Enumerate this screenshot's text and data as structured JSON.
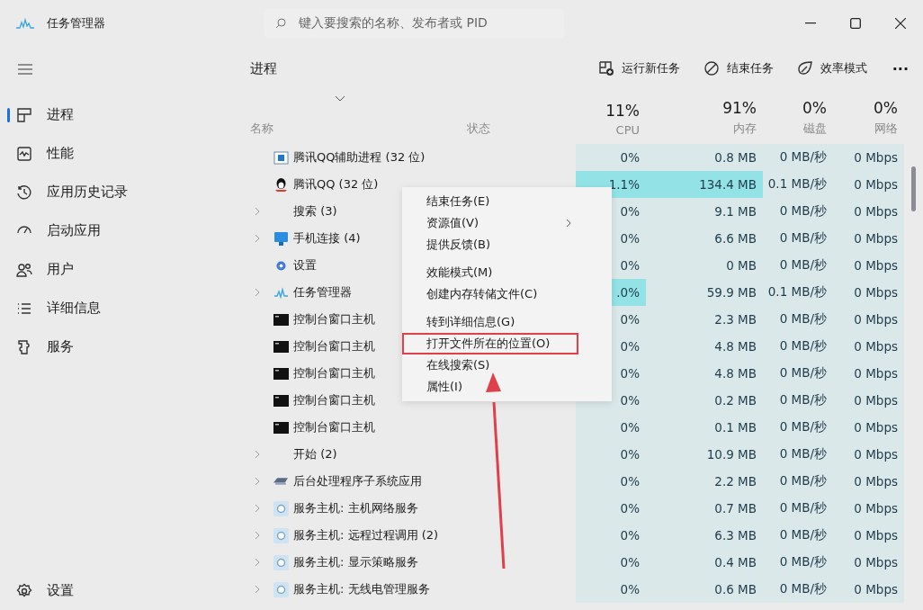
{
  "window": {
    "title": "任务管理器"
  },
  "search": {
    "placeholder": "键入要搜索的名称、发布者或 PID"
  },
  "sidebar": {
    "items": [
      {
        "label": "进程",
        "selected": true
      },
      {
        "label": "性能",
        "selected": false
      },
      {
        "label": "应用历史记录",
        "selected": false
      },
      {
        "label": "启动应用",
        "selected": false
      },
      {
        "label": "用户",
        "selected": false
      },
      {
        "label": "详细信息",
        "selected": false
      },
      {
        "label": "服务",
        "selected": false
      }
    ],
    "footer": {
      "label": "设置"
    }
  },
  "page": {
    "title": "进程",
    "actions": [
      {
        "label": "运行新任务"
      },
      {
        "label": "结束任务"
      },
      {
        "label": "效率模式"
      }
    ],
    "more": "···"
  },
  "table": {
    "columns": [
      {
        "label": "名称"
      },
      {
        "label": "状态"
      },
      {
        "label": "CPU",
        "total": "11%"
      },
      {
        "label": "内存",
        "total": "91%"
      },
      {
        "label": "磁盘",
        "total": "0%"
      },
      {
        "label": "网络",
        "total": "0%"
      }
    ],
    "rows": [
      {
        "name": "腾讯QQ辅助进程 (32 位)",
        "expandable": false,
        "kind": "app",
        "cpu": "0%",
        "memory": "0.8 MB",
        "disk": "0 MB/秒",
        "network": "0 Mbps",
        "cpu_hot": false,
        "mem_hot": false
      },
      {
        "name": "腾讯QQ (32 位)",
        "expandable": false,
        "kind": "penguin",
        "cpu": "1.1%",
        "memory": "134.4 MB",
        "disk": "0.1 MB/秒",
        "network": "0 Mbps",
        "cpu_hot": true,
        "mem_hot": true
      },
      {
        "name": "搜索 (3)",
        "expandable": true,
        "kind": "group",
        "cpu": "0%",
        "memory": "9.1 MB",
        "disk": "0 MB/秒",
        "network": "0 Mbps",
        "cpu_hot": false,
        "mem_hot": false
      },
      {
        "name": "手机连接 (4)",
        "expandable": true,
        "kind": "monitor",
        "cpu": "0%",
        "memory": "6.6 MB",
        "disk": "0 MB/秒",
        "network": "0 Mbps",
        "cpu_hot": false,
        "mem_hot": false
      },
      {
        "name": "设置",
        "expandable": false,
        "kind": "gear",
        "cpu": "0%",
        "memory": "0 MB",
        "disk": "0 MB/秒",
        "network": "0 Mbps",
        "cpu_hot": false,
        "mem_hot": false
      },
      {
        "name": "任务管理器",
        "expandable": true,
        "kind": "pulse",
        "cpu": ".0%",
        "memory": "59.9 MB",
        "disk": "0.1 MB/秒",
        "network": "0 Mbps",
        "cpu_hot": true,
        "mem_hot": false
      },
      {
        "name": "控制台窗口主机",
        "expandable": false,
        "kind": "console",
        "cpu": "0%",
        "memory": "2.3 MB",
        "disk": "0 MB/秒",
        "network": "0 Mbps",
        "cpu_hot": false,
        "mem_hot": false
      },
      {
        "name": "控制台窗口主机",
        "expandable": false,
        "kind": "console",
        "cpu": "0%",
        "memory": "4.8 MB",
        "disk": "0 MB/秒",
        "network": "0 Mbps",
        "cpu_hot": false,
        "mem_hot": false
      },
      {
        "name": "控制台窗口主机",
        "expandable": false,
        "kind": "console",
        "cpu": "0%",
        "memory": "4.8 MB",
        "disk": "0 MB/秒",
        "network": "0 Mbps",
        "cpu_hot": false,
        "mem_hot": false
      },
      {
        "name": "控制台窗口主机",
        "expandable": false,
        "kind": "console",
        "cpu": "0%",
        "memory": "0.2 MB",
        "disk": "0 MB/秒",
        "network": "0 Mbps",
        "cpu_hot": false,
        "mem_hot": false
      },
      {
        "name": "控制台窗口主机",
        "expandable": false,
        "kind": "console",
        "cpu": "0%",
        "memory": "0.1 MB",
        "disk": "0 MB/秒",
        "network": "0 Mbps",
        "cpu_hot": false,
        "mem_hot": false
      },
      {
        "name": "开始 (2)",
        "expandable": true,
        "kind": "group",
        "cpu": "0%",
        "memory": "10.9 MB",
        "disk": "0 MB/秒",
        "network": "0 Mbps",
        "cpu_hot": false,
        "mem_hot": false
      },
      {
        "name": "后台处理程序子系统应用",
        "expandable": true,
        "kind": "printer",
        "cpu": "0%",
        "memory": "2.2 MB",
        "disk": "0 MB/秒",
        "network": "0 Mbps",
        "cpu_hot": false,
        "mem_hot": false
      },
      {
        "name": "服务主机: 主机网络服务",
        "expandable": true,
        "kind": "service",
        "cpu": "0%",
        "memory": "0.7 MB",
        "disk": "0 MB/秒",
        "network": "0 Mbps",
        "cpu_hot": false,
        "mem_hot": false
      },
      {
        "name": "服务主机: 远程过程调用 (2)",
        "expandable": true,
        "kind": "service",
        "cpu": "0%",
        "memory": "6.3 MB",
        "disk": "0 MB/秒",
        "network": "0 Mbps",
        "cpu_hot": false,
        "mem_hot": false
      },
      {
        "name": "服务主机: 显示策略服务",
        "expandable": true,
        "kind": "service",
        "cpu": "0%",
        "memory": "0.4 MB",
        "disk": "0 MB/秒",
        "network": "0 Mbps",
        "cpu_hot": false,
        "mem_hot": false
      },
      {
        "name": "服务主机: 无线电管理服务",
        "expandable": true,
        "kind": "service",
        "cpu": "0%",
        "memory": "0.6 MB",
        "disk": "0 MB/秒",
        "network": "0 Mbps",
        "cpu_hot": false,
        "mem_hot": false
      }
    ]
  },
  "context_menu": {
    "groups": [
      [
        {
          "label": "结束任务(E)",
          "submenu": false,
          "highlighted": false
        },
        {
          "label": "资源值(V)",
          "submenu": true,
          "highlighted": false
        },
        {
          "label": "提供反馈(B)",
          "submenu": false,
          "highlighted": false
        }
      ],
      [
        {
          "label": "效能模式(M)",
          "submenu": false,
          "highlighted": false
        },
        {
          "label": "创建内存转储文件(C)",
          "submenu": false,
          "highlighted": false
        }
      ],
      [
        {
          "label": "转到详细信息(G)",
          "submenu": false,
          "highlighted": false
        },
        {
          "label": "打开文件所在的位置(O)",
          "submenu": false,
          "highlighted": true
        },
        {
          "label": "在线搜索(S)",
          "submenu": false,
          "highlighted": false
        },
        {
          "label": "属性(I)",
          "submenu": false,
          "highlighted": false
        }
      ]
    ]
  }
}
